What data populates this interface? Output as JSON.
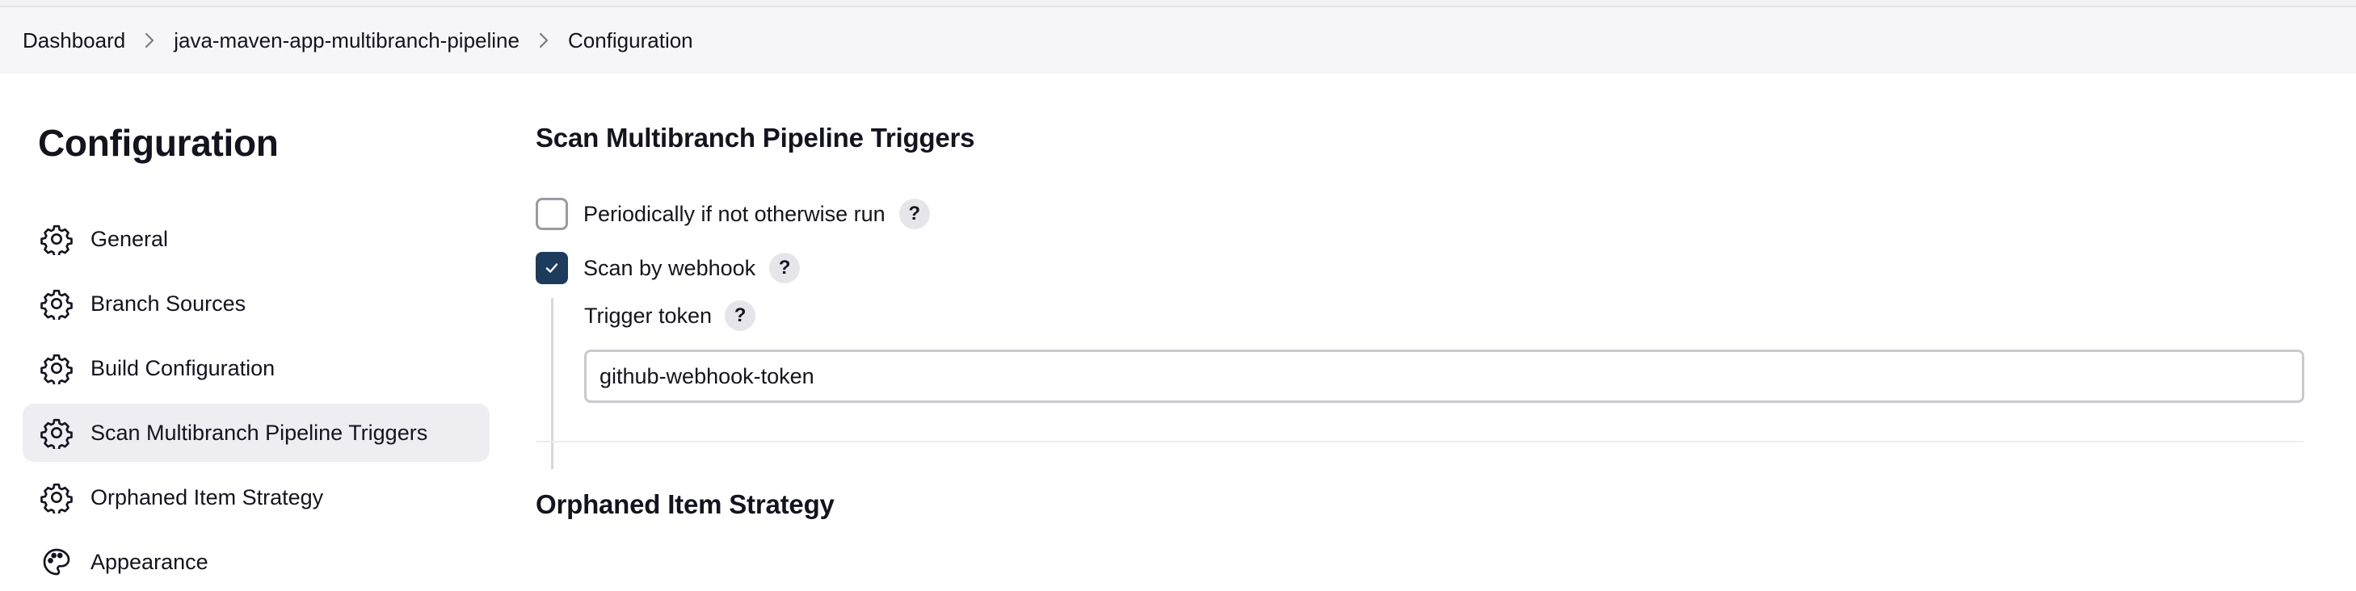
{
  "breadcrumb": {
    "items": [
      {
        "label": "Dashboard"
      },
      {
        "label": "java-maven-app-multibranch-pipeline"
      },
      {
        "label": "Configuration"
      }
    ],
    "separator_icon": "chevron-right-icon"
  },
  "sidebar": {
    "title": "Configuration",
    "items": [
      {
        "label": "General",
        "icon": "gear-icon",
        "active": false
      },
      {
        "label": "Branch Sources",
        "icon": "gear-icon",
        "active": false
      },
      {
        "label": "Build Configuration",
        "icon": "gear-icon",
        "active": false
      },
      {
        "label": "Scan Multibranch Pipeline Triggers",
        "icon": "gear-icon",
        "active": true
      },
      {
        "label": "Orphaned Item Strategy",
        "icon": "gear-icon",
        "active": false
      },
      {
        "label": "Appearance",
        "icon": "palette-icon",
        "active": false
      }
    ]
  },
  "main": {
    "triggers": {
      "title": "Scan Multibranch Pipeline Triggers",
      "periodically": {
        "label": "Periodically if not otherwise run",
        "checked": false,
        "help": "?"
      },
      "webhook": {
        "label": "Scan by webhook",
        "checked": true,
        "help": "?"
      },
      "trigger_token": {
        "label": "Trigger token",
        "help": "?",
        "value": "github-webhook-token"
      }
    },
    "orphaned": {
      "title": "Orphaned Item Strategy"
    }
  },
  "colors": {
    "accent": "#1d3b5c",
    "active_bg": "#ededf2",
    "breadcrumb_bg": "#f6f6f8"
  }
}
